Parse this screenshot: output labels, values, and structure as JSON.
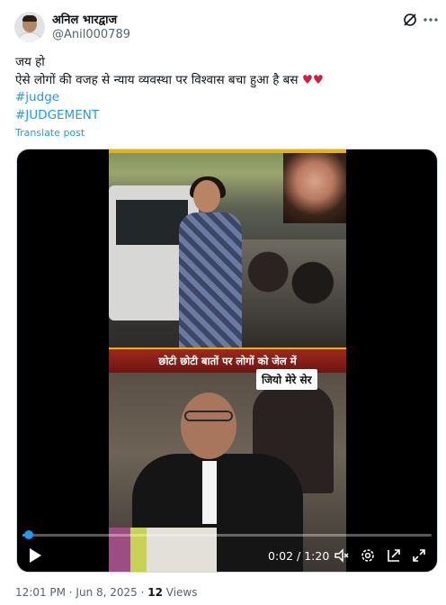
{
  "author": {
    "display_name": "अनिल भारद्वाज",
    "handle": "@Anil000789"
  },
  "tweet": {
    "line1": "जय हो",
    "line2_text": "ऐसे लोगों की वजह से न्याय व्यवस्था पर विश्वास बचा हुआ है बस",
    "line2_emoji": "♥♥",
    "hashtag1": "#judge",
    "hashtag2": "#JUDGEMENT",
    "translate_label": "Translate post"
  },
  "video": {
    "caption_text": "छोटी छोटी बातों पर लोगों को जेल में",
    "sub_label": "जियो मेरे सेर",
    "time_display": "0:02 / 1:20",
    "progress": 0.016
  },
  "meta": {
    "timestamp": "12:01 PM · Jun 8, 2025 · ",
    "views_count": "12",
    "views_label": " Views"
  },
  "icons": [
    "avatar",
    "grok-icon",
    "more-icon",
    "play-icon",
    "volume-icon",
    "settings-icon",
    "pop-out-icon",
    "fullscreen-icon"
  ],
  "colors": {
    "link": "#1d9bf0",
    "heart": "#cf1f3d",
    "secondary_text": "#536471"
  }
}
